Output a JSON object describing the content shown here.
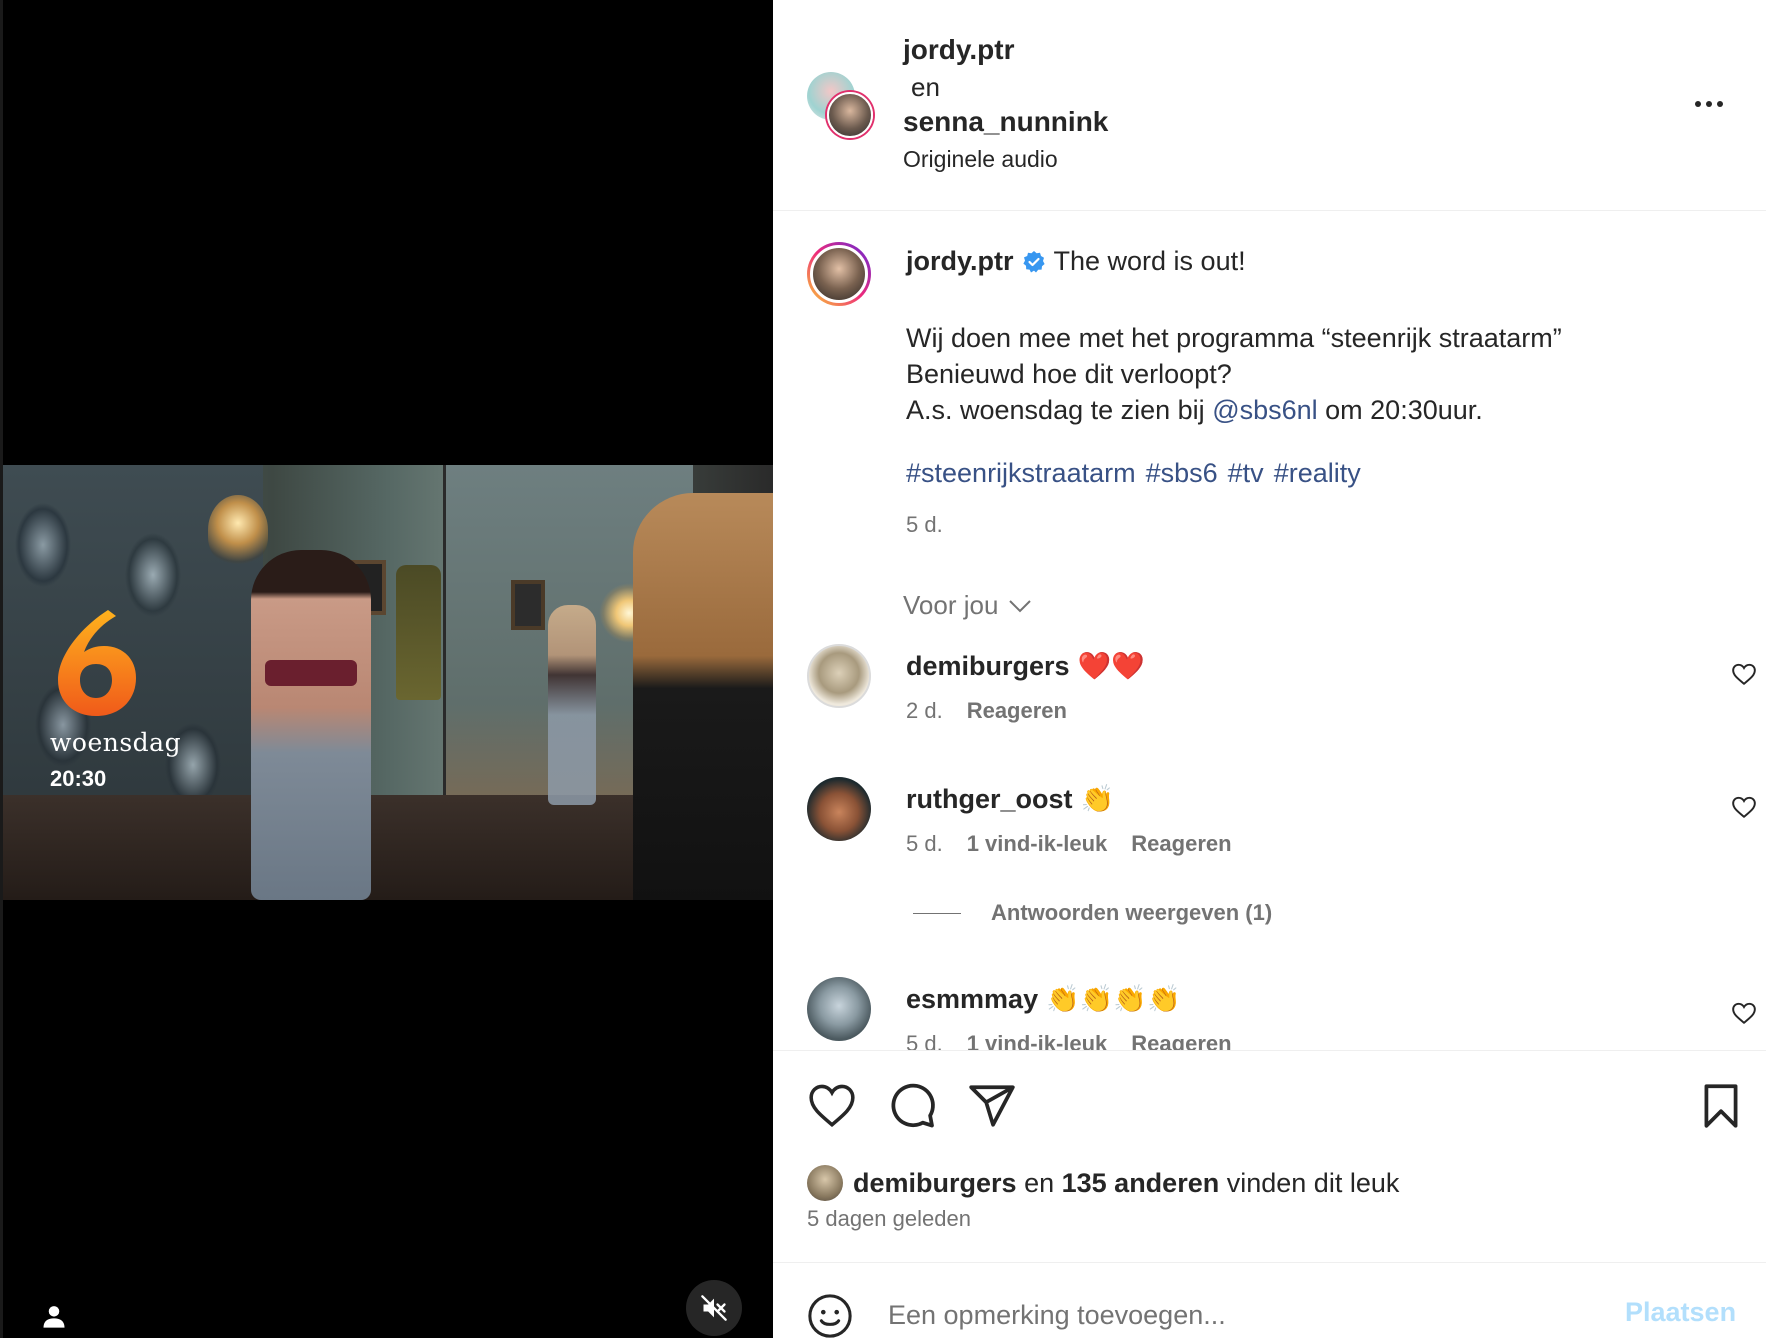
{
  "video": {
    "logo_digit": "6",
    "overlay_day": "woensdag",
    "overlay_time": "20:30",
    "muted": true,
    "icons": [
      "tagged-people-icon",
      "muted-speaker-icon"
    ]
  },
  "header": {
    "user1": "jordy.ptr",
    "conjunction": "en",
    "user2": "senna_nunnink",
    "audio": "Originele audio"
  },
  "caption": {
    "username": "jordy.ptr",
    "verified": true,
    "first_line": "The word is out!",
    "line2": "Wij doen mee met het programma “steenrijk straatarm”",
    "line3": "Benieuwd hoe dit verloopt?",
    "line4_before": "A.s. woensdag te zien bij ",
    "mention": "@sbs6nl",
    "line4_after": " om 20:30uur.",
    "hashtags": [
      "#steenrijkstraatarm",
      "#sbs6",
      "#tv",
      "#reality"
    ],
    "time": "5 d."
  },
  "comments_section": {
    "filter_label": "Voor jou",
    "comments": [
      {
        "user": "demiburgers",
        "text": "❤️❤️",
        "time": "2 d.",
        "likes": "",
        "reply": "Reageren"
      },
      {
        "user": "ruthger_oost",
        "text": "👏",
        "time": "5 d.",
        "likes": "1 vind-ik-leuk",
        "reply": "Reageren"
      },
      {
        "user": "esmmmay",
        "text": "👏👏👏👏",
        "time": "5 d.",
        "likes": "1 vind-ik-leuk",
        "reply": "Reageren"
      }
    ],
    "view_replies": "Antwoorden weergeven (1)"
  },
  "actions": {
    "liked_by_user": "demiburgers",
    "liked_by_and": "en",
    "liked_by_others": "135 anderen",
    "liked_by_suffix": "vinden dit leuk",
    "posted_ago": "5 dagen geleden"
  },
  "add_comment": {
    "placeholder": "Een opmerking toevoegen...",
    "post_label": "Plaatsen"
  },
  "colors": {
    "link": "#385185",
    "muted_text": "#737373",
    "post_disabled": "#b2dffc",
    "verified": "#3897f0",
    "sbs_orange": "#f26b1d"
  }
}
